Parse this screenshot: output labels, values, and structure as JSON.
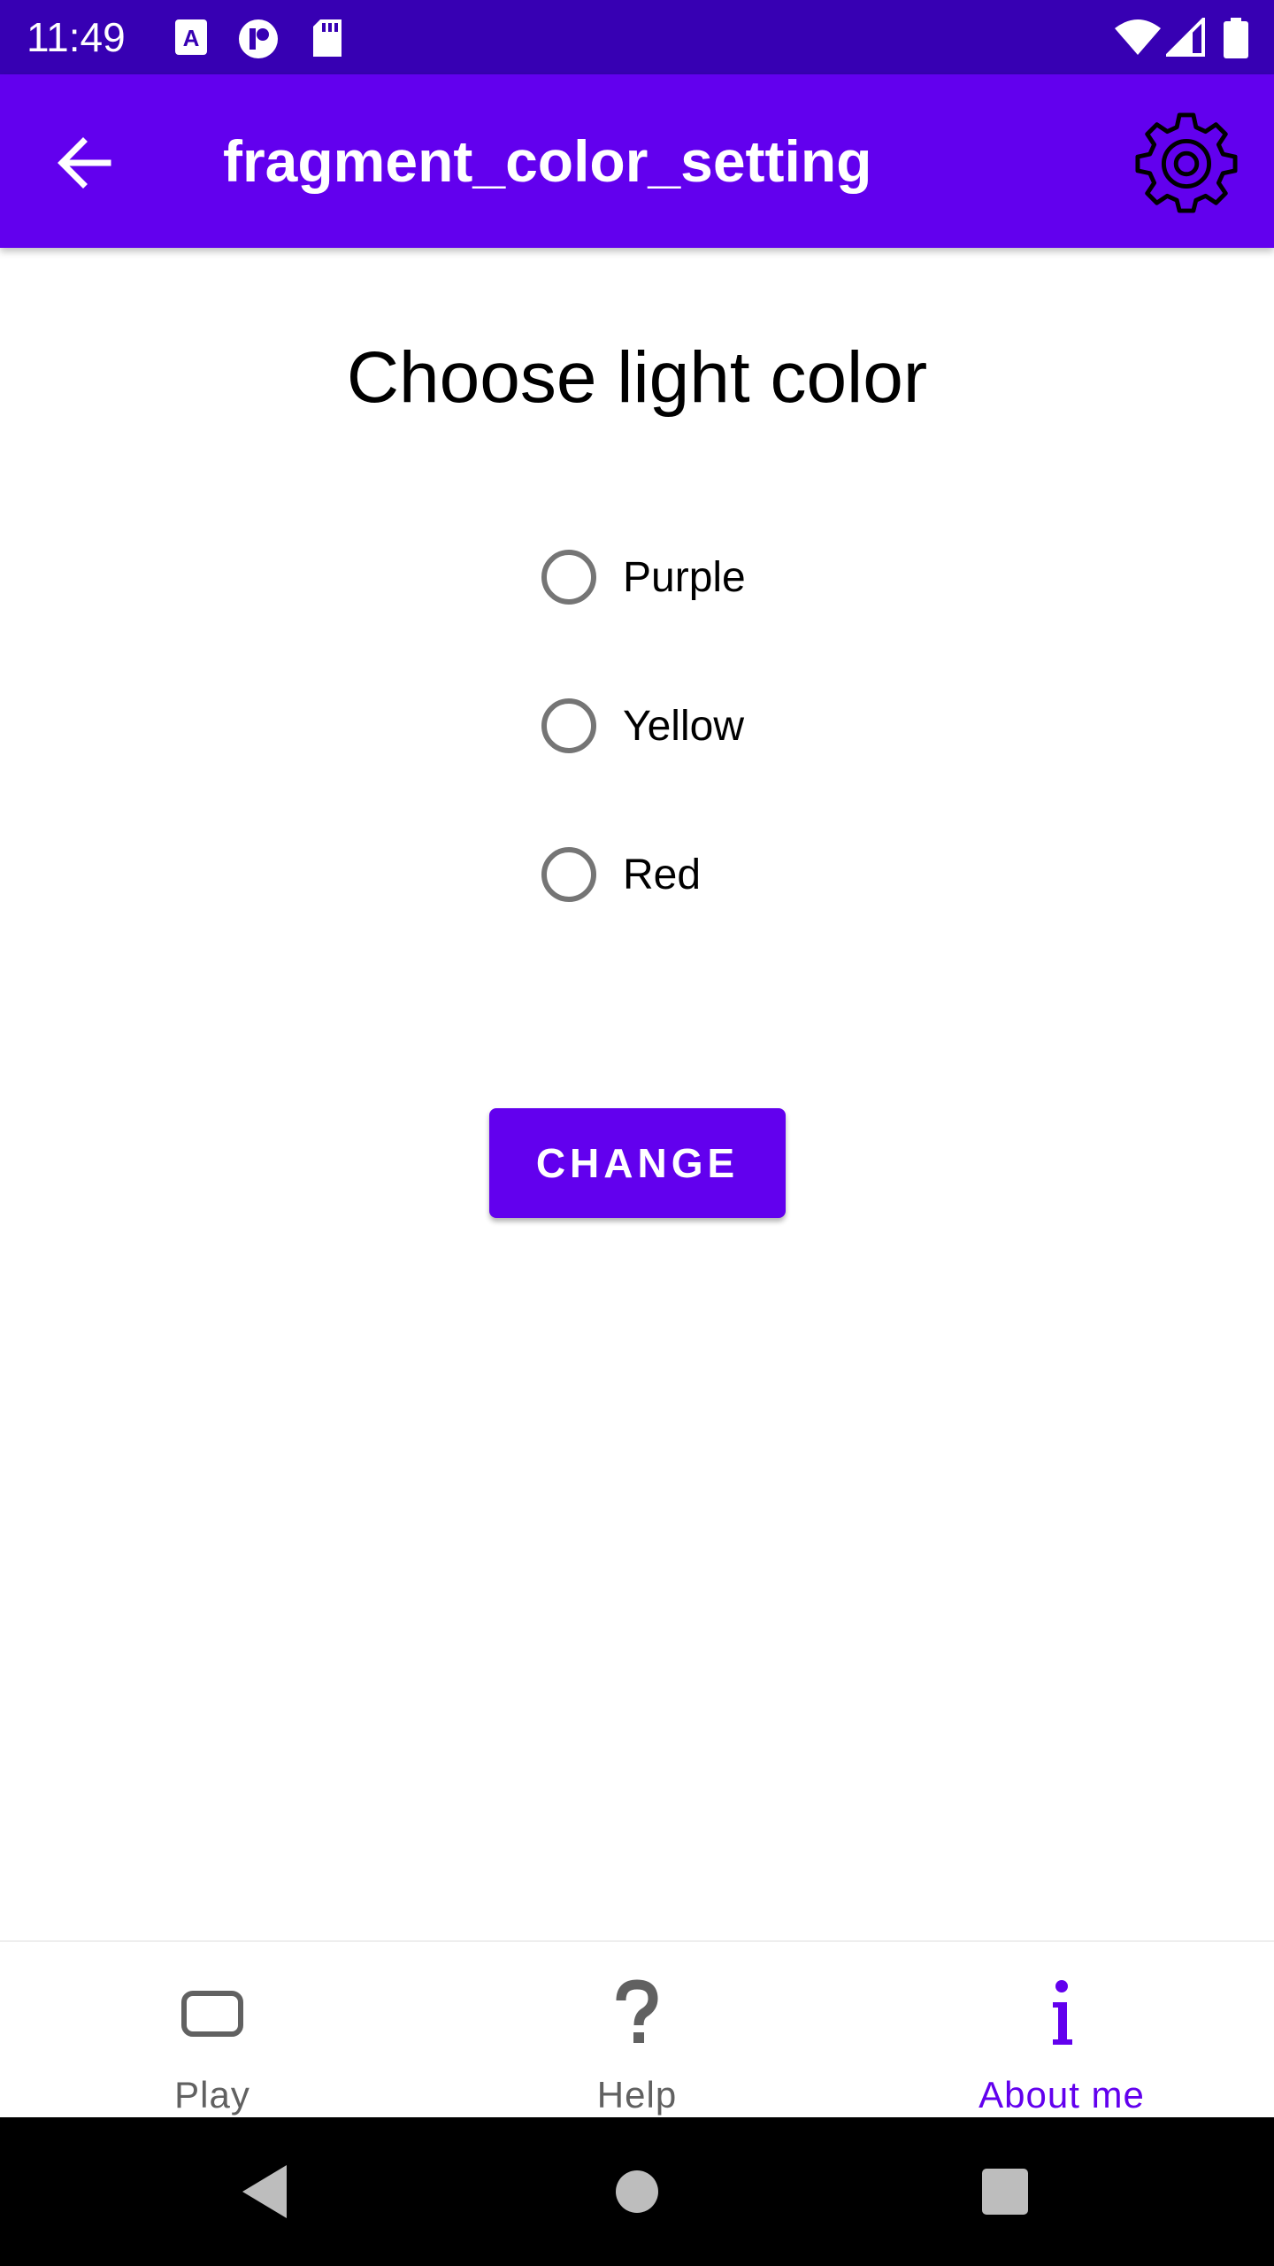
{
  "status_bar": {
    "time": "11:49",
    "left_icons": [
      "a-accessibility-icon",
      "notification-app-icon",
      "sd-card-icon"
    ],
    "right_icons": [
      "wifi-icon",
      "signal-icon",
      "battery-icon"
    ]
  },
  "app_bar": {
    "title": "fragment_color_setting",
    "back_icon": "arrow-left-icon",
    "settings_icon": "gear-icon"
  },
  "content": {
    "heading": "Choose light color",
    "options": [
      {
        "label": "Purple",
        "selected": false
      },
      {
        "label": "Yellow",
        "selected": false
      },
      {
        "label": "Red",
        "selected": false
      }
    ],
    "button_label": "CHANGE"
  },
  "bottom_nav": {
    "items": [
      {
        "label": "Play",
        "icon": "play-frame-icon",
        "active": false
      },
      {
        "label": "Help",
        "icon": "question-icon",
        "active": false
      },
      {
        "label": "About me",
        "icon": "info-icon",
        "active": true
      }
    ]
  },
  "system_nav": {
    "buttons": [
      "back-triangle-icon",
      "home-circle-icon",
      "recents-square-icon"
    ]
  },
  "colors": {
    "status_bar": "#3700b3",
    "primary": "#6200ee",
    "radio_border": "#757575",
    "nav_inactive": "#616161"
  }
}
